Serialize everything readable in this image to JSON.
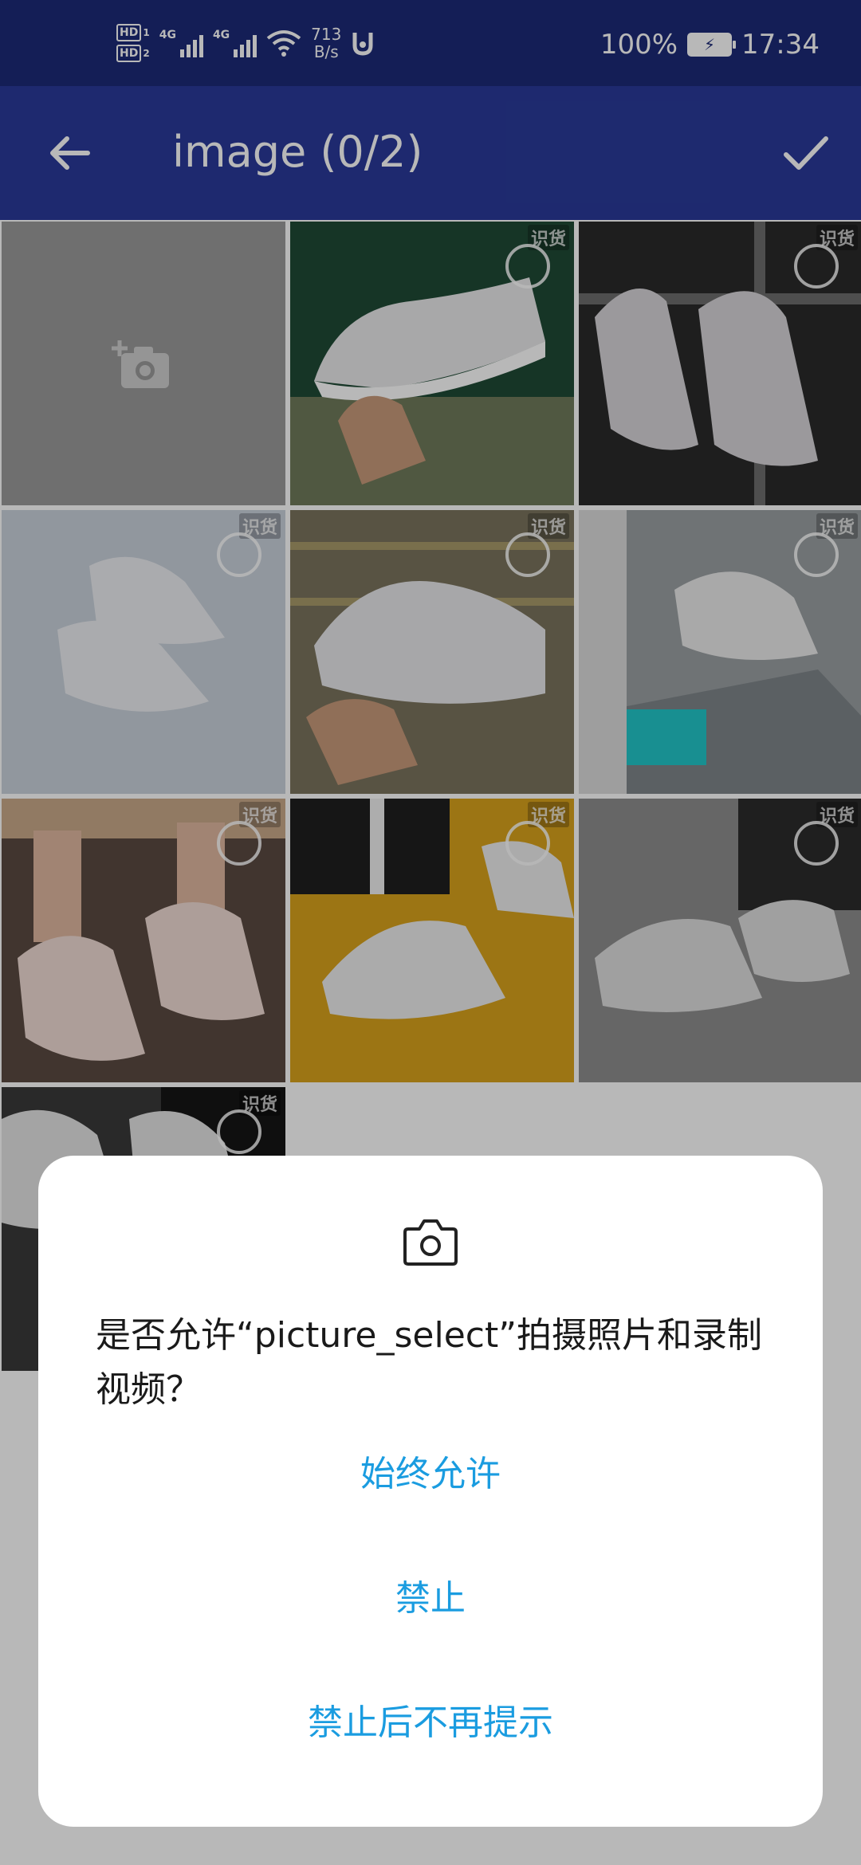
{
  "status_bar": {
    "hd1": "HD",
    "hd1_sub": "1",
    "hd2": "HD",
    "hd2_sub": "2",
    "signal1_label": "4G",
    "signal2_label": "4G",
    "net_speed_value": "713",
    "net_speed_unit": "B/s",
    "battery_percent": "100%",
    "time": "17:34"
  },
  "app_bar": {
    "title": "image (0/2)",
    "back_icon": "arrow-left-icon",
    "confirm_icon": "check-icon"
  },
  "grid": {
    "camera_icon": "add-photo-icon",
    "watermark": "识货",
    "photos": [
      {
        "name": "photo-1",
        "bg": "#1f4a35"
      },
      {
        "name": "photo-2",
        "bg": "#2a2a2a"
      },
      {
        "name": "photo-3",
        "bg": "#c9d1dc"
      },
      {
        "name": "photo-4",
        "bg": "#7a735e"
      },
      {
        "name": "photo-5",
        "bg": "#9aa0a3"
      },
      {
        "name": "photo-6",
        "bg": "#5a4a42"
      },
      {
        "name": "photo-7",
        "bg": "#d8a21c"
      },
      {
        "name": "photo-8",
        "bg": "#8e8e8e"
      },
      {
        "name": "photo-9",
        "bg": "#3a3a3a"
      }
    ]
  },
  "dialog": {
    "icon": "camera-icon",
    "message": "是否允许“picture_select”拍摄照片和录制视频？",
    "allow_always": "始终允许",
    "deny": "禁止",
    "deny_dont_ask": "禁止后不再提示"
  },
  "colors": {
    "status_bar": "#1d2a78",
    "app_bar": "#2a3a9a",
    "dialog_button": "#1a9ce0"
  }
}
